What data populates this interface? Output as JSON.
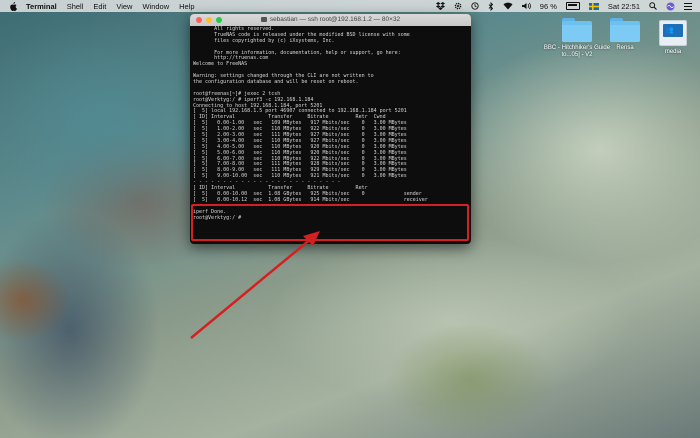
{
  "menubar": {
    "app_name": "Terminal",
    "menus": [
      "Shell",
      "Edit",
      "View",
      "Window",
      "Help"
    ],
    "battery_percent": "96 %",
    "clock": "Sat 22:51"
  },
  "desktop": {
    "icons": [
      {
        "label": "BBC - Hitchhiker's Guide to...05] - V2",
        "type": "folder"
      },
      {
        "label": "Rensa",
        "type": "folder"
      },
      {
        "label": "media",
        "type": "server"
      }
    ]
  },
  "terminal": {
    "title": "sebastian — ssh root@192.168.1.2 — 80×32",
    "lines": [
      "       All rights reserved.",
      "       TrueNAS code is released under the modified BSD license with some",
      "       files copyrighted by (c) iXsystems, Inc.",
      "",
      "       For more information, documentation, help or support, go here:",
      "       http://truenas.com",
      "Welcome to FreeNAS",
      "",
      "Warning: settings changed through the CLI are not written to",
      "the configuration database and will be reset on reboot.",
      "",
      "root@freenas[~]# jexec 2 tcsh",
      "root@Verktyg:/ # iperf3 -c 192.168.1.184",
      "Connecting to host 192.168.1.184, port 5201",
      "[  5] local 192.168.1.5 port 46907 connected to 192.168.1.184 port 5201",
      "[ ID] Interval           Transfer     Bitrate         Retr  Cwnd",
      "[  5]   0.00-1.00   sec   109 MBytes   917 Mbits/sec    0   3.00 MBytes",
      "[  5]   1.00-2.00   sec   110 MBytes   922 Mbits/sec    0   3.00 MBytes",
      "[  5]   2.00-3.00   sec   111 MBytes   927 Mbits/sec    0   3.00 MBytes",
      "[  5]   3.00-4.00   sec   110 MBytes   927 Mbits/sec    0   3.00 MBytes",
      "[  5]   4.00-5.00   sec   110 MBytes   920 Mbits/sec    0   3.00 MBytes",
      "[  5]   5.00-6.00   sec   110 MBytes   920 Mbits/sec    0   3.00 MBytes",
      "[  5]   6.00-7.00   sec   110 MBytes   922 Mbits/sec    0   3.00 MBytes",
      "[  5]   7.00-8.00   sec   111 MBytes   928 Mbits/sec    0   3.00 MBytes",
      "[  5]   8.00-9.00   sec   111 MBytes   929 Mbits/sec    0   3.00 MBytes",
      "[  5]   9.00-10.00  sec   110 MBytes   921 Mbits/sec    0   3.00 MBytes",
      "- - - - - - - - - - - - - - - - - - - - - - - - -",
      "[ ID] Interval           Transfer     Bitrate         Retr",
      "[  5]   0.00-10.00  sec  1.08 GBytes   925 Mbits/sec    0             sender",
      "[  5]   0.00-10.12  sec  1.08 GBytes   914 Mbits/sec                  receiver",
      "",
      "iperf Done.",
      "root@Verktyg:/ #"
    ]
  }
}
